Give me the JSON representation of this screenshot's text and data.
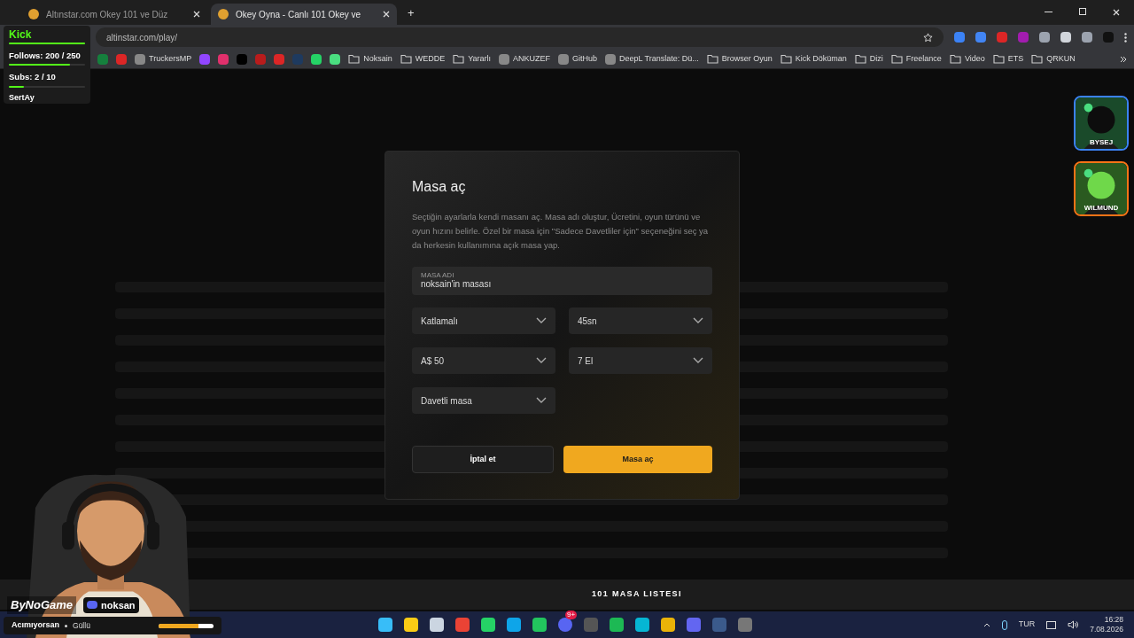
{
  "browser": {
    "tabs": [
      {
        "title": "Altınstar.com Okey 101 ve Düz",
        "selected": false
      },
      {
        "title": "Okey Oyna - Canlı 101 Okey ve",
        "selected": true
      }
    ],
    "new_tab": "+",
    "url": "altinstar.com/play/",
    "bookmarks": [
      {
        "kind": "site",
        "label": "TruckersMP"
      },
      {
        "kind": "folder",
        "label": "Noksain"
      },
      {
        "kind": "folder",
        "label": "WEDDE"
      },
      {
        "kind": "folder",
        "label": "Yararlı"
      },
      {
        "kind": "site",
        "label": "ANKUZEF"
      },
      {
        "kind": "site",
        "label": "GitHub"
      },
      {
        "kind": "site",
        "label": "DeepL Translate: Dü..."
      },
      {
        "kind": "folder",
        "label": "Browser Oyun"
      },
      {
        "kind": "folder",
        "label": "Kick Döküman"
      },
      {
        "kind": "folder",
        "label": "Dizi"
      },
      {
        "kind": "folder",
        "label": "Freelance"
      },
      {
        "kind": "folder",
        "label": "Video"
      },
      {
        "kind": "folder",
        "label": "ETS"
      },
      {
        "kind": "folder",
        "label": "QRKUN"
      }
    ]
  },
  "dialog": {
    "title": "Masa aç",
    "description": "Seçtiğin ayarlarla kendi masanı aç. Masa adı oluştur, Ücretini, oyun türünü ve oyun hızını belirle. Özel bir masa için \"Sadece Davetliler için\" seçeneğini seç ya da herkesin kullanımına açık masa yap.",
    "name_field": {
      "label": "MASA ADI",
      "value": "noksain'in masası"
    },
    "selects": [
      {
        "value": "Katlamalı"
      },
      {
        "value": "45sn"
      },
      {
        "value": "A$ 50"
      },
      {
        "value": "7 El"
      },
      {
        "value": "Davetli masa"
      }
    ],
    "buttons": [
      {
        "kind": "secondary",
        "label": "İptal et"
      },
      {
        "kind": "primary",
        "label": "Masa aç"
      }
    ]
  },
  "bottom_bar": {
    "title": "101 MASA LISTESI"
  },
  "stream_overlay": {
    "platform": "Kick",
    "follows": {
      "text": "Follows: 200 / 250",
      "level": 0.8
    },
    "subs": {
      "text": "Subs: 2 / 10",
      "level": 0.2
    },
    "latest": "SertAy",
    "sponsor": "ByNoGame",
    "discord": "noksan",
    "song": {
      "title": "Acımıyorsan",
      "artist": "Güllü",
      "level": 0.72
    },
    "guests": [
      {
        "name": "BYSEJ",
        "color": "#3b82f6"
      },
      {
        "name": "WILMUND",
        "color": "#f97316"
      }
    ]
  },
  "taskbar": {
    "discord_badge": "9+",
    "language": "TUR",
    "time": "16:28",
    "date": "7.08.2026"
  }
}
